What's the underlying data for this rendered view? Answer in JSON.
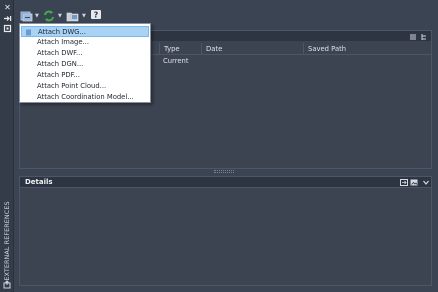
{
  "palette": {
    "panel_bg": "#3b4453",
    "header_bg": "#2e3542",
    "menu_bg": "#ffffff",
    "menu_selected": "#a9d3f5",
    "refresh_green": "#3cb043"
  },
  "strip": {
    "close_icon": "close-icon",
    "autohide_icon": "autohide-icon",
    "properties_icon": "properties-icon",
    "title": "EXTERNAL REFERENCES"
  },
  "toolbar": {
    "attach_icon": "attach-icon",
    "refresh_icon": "refresh-icon",
    "change_path_icon": "change-path-icon",
    "help_icon": "help-icon"
  },
  "table": {
    "columns": [
      "Type",
      "Date",
      "Saved Path"
    ],
    "rows": [
      {
        "type": "Current",
        "date": "",
        "saved_path": ""
      }
    ]
  },
  "details": {
    "title": "Details"
  },
  "menu": {
    "items": [
      {
        "label": "Attach DWG...",
        "selected": true
      },
      {
        "label": "Attach Image...",
        "selected": false
      },
      {
        "label": "Attach DWF...",
        "selected": false
      },
      {
        "label": "Attach DGN...",
        "selected": false
      },
      {
        "label": "Attach PDF...",
        "selected": false
      },
      {
        "label": "Attach Point Cloud...",
        "selected": false
      },
      {
        "label": "Attach Coordination Model...",
        "selected": false
      }
    ]
  }
}
